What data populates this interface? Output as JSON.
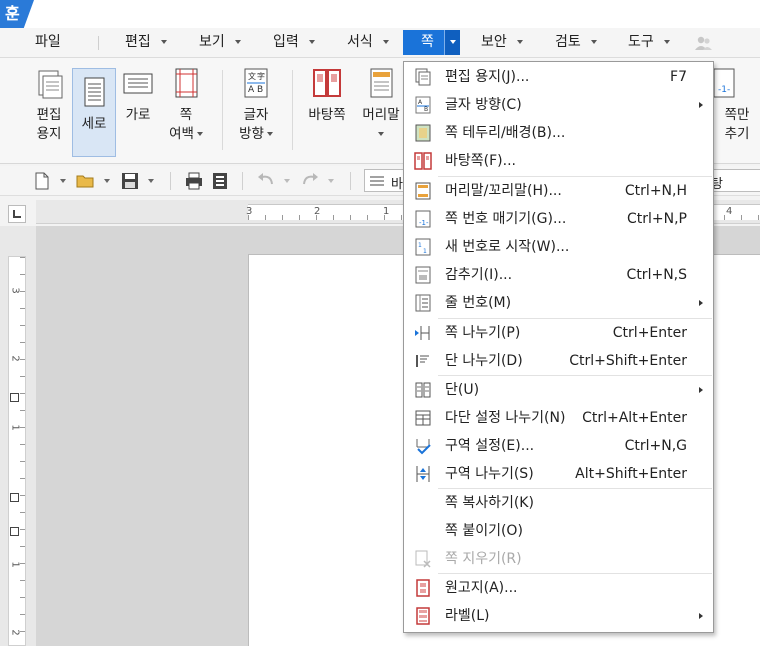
{
  "app": {
    "logo_char": "훈"
  },
  "menubar": {
    "items": [
      {
        "label": "파일"
      },
      {
        "label": "편집"
      },
      {
        "label": "보기"
      },
      {
        "label": "입력"
      },
      {
        "label": "서식"
      },
      {
        "label": "쪽"
      },
      {
        "label": "보안"
      },
      {
        "label": "검토"
      },
      {
        "label": "도구"
      }
    ]
  },
  "ribbon": {
    "edit_paper_line1": "편집",
    "edit_paper_line2": "용지",
    "portrait": "세로",
    "landscape": "가로",
    "margin_line1": "쪽",
    "margin_line2": "여백",
    "text_dir_line1": "글자",
    "text_dir_line2": "방향",
    "background": "바탕쪽",
    "header": "머리말",
    "hide_line1": "쪽만",
    "hide_line2": "추기"
  },
  "toolbar": {
    "style_prefix": "바",
    "style_suffix": "탕"
  },
  "ruler": {
    "h_labels": [
      "3",
      "2",
      "1",
      "4"
    ],
    "v_labels": [
      "3",
      "2",
      "1",
      "1",
      "2"
    ]
  },
  "dropdown": {
    "items": [
      {
        "label": "편집 용지(J)...",
        "shortcut": "F7",
        "icon": "page-setup-icon"
      },
      {
        "label": "글자 방향(C)",
        "shortcut": "",
        "icon": "text-direction-icon",
        "submenu": true
      },
      {
        "label": "쪽 테두리/배경(B)...",
        "shortcut": "",
        "icon": "page-border-icon"
      },
      {
        "label": "바탕쪽(F)...",
        "shortcut": "",
        "icon": "master-page-icon"
      },
      {
        "label": "머리말/꼬리말(H)...",
        "shortcut": "Ctrl+N,H",
        "icon": "header-footer-icon"
      },
      {
        "label": "쪽 번호 매기기(G)...",
        "shortcut": "Ctrl+N,P",
        "icon": "page-number-icon"
      },
      {
        "label": "새 번호로 시작(W)...",
        "shortcut": "",
        "icon": "new-number-icon"
      },
      {
        "label": "감추기(I)...",
        "shortcut": "Ctrl+N,S",
        "icon": "hide-icon"
      },
      {
        "label": "줄 번호(M)",
        "shortcut": "",
        "icon": "line-number-icon",
        "submenu": true
      },
      {
        "label": "쪽 나누기(P)",
        "shortcut": "Ctrl+Enter",
        "icon": "page-break-icon"
      },
      {
        "label": "단 나누기(D)",
        "shortcut": "Ctrl+Shift+Enter",
        "icon": "column-break-icon"
      },
      {
        "label": "단(U)",
        "shortcut": "",
        "icon": "columns-icon",
        "submenu": true
      },
      {
        "label": "다단 설정 나누기(N)",
        "shortcut": "Ctrl+Alt+Enter",
        "icon": "multi-column-icon"
      },
      {
        "label": "구역 설정(E)...",
        "shortcut": "Ctrl+N,G",
        "icon": "section-setup-icon"
      },
      {
        "label": "구역 나누기(S)",
        "shortcut": "Alt+Shift+Enter",
        "icon": "section-break-icon"
      },
      {
        "label": "쪽 복사하기(K)",
        "shortcut": "",
        "icon": ""
      },
      {
        "label": "쪽 붙이기(O)",
        "shortcut": "",
        "icon": ""
      },
      {
        "label": "쪽 지우기(R)",
        "shortcut": "",
        "icon": "delete-page-icon",
        "disabled": true
      },
      {
        "label": "원고지(A)...",
        "shortcut": "",
        "icon": "manuscript-icon"
      },
      {
        "label": "라벨(L)",
        "shortcut": "",
        "icon": "label-icon",
        "submenu": true
      }
    ]
  },
  "colors": {
    "accent": "#1a73d9",
    "ribbon_selected": "#d9e6f5"
  }
}
